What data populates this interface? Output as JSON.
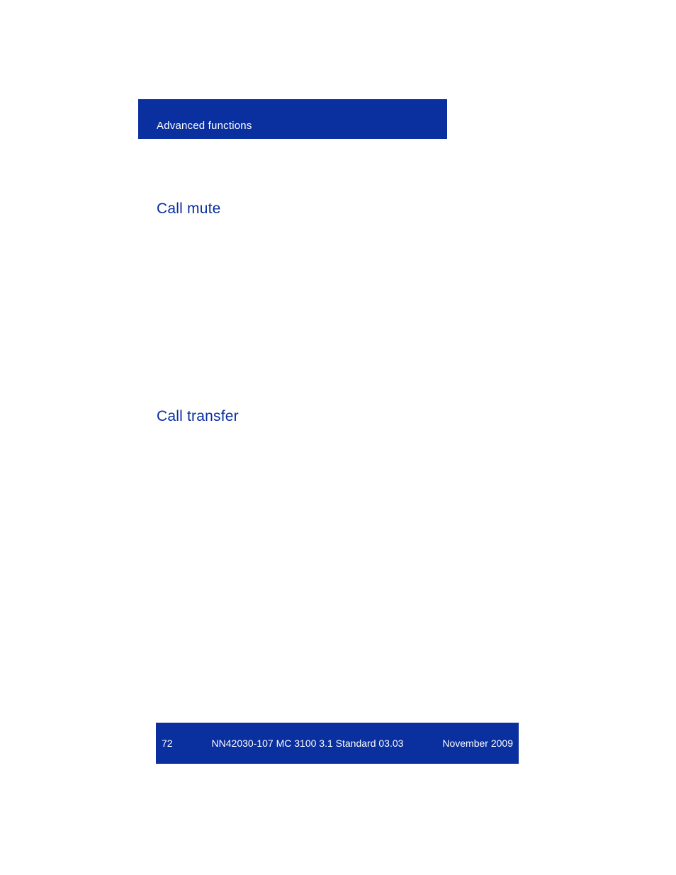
{
  "header": {
    "section_title": "Advanced functions"
  },
  "sections": {
    "call_mute_heading": "Call mute",
    "call_transfer_heading": "Call transfer"
  },
  "footer": {
    "page_number": "72",
    "center_text": "NN42030-107 MC 3100  3.1 Standard 03.03",
    "date": "November 2009"
  }
}
